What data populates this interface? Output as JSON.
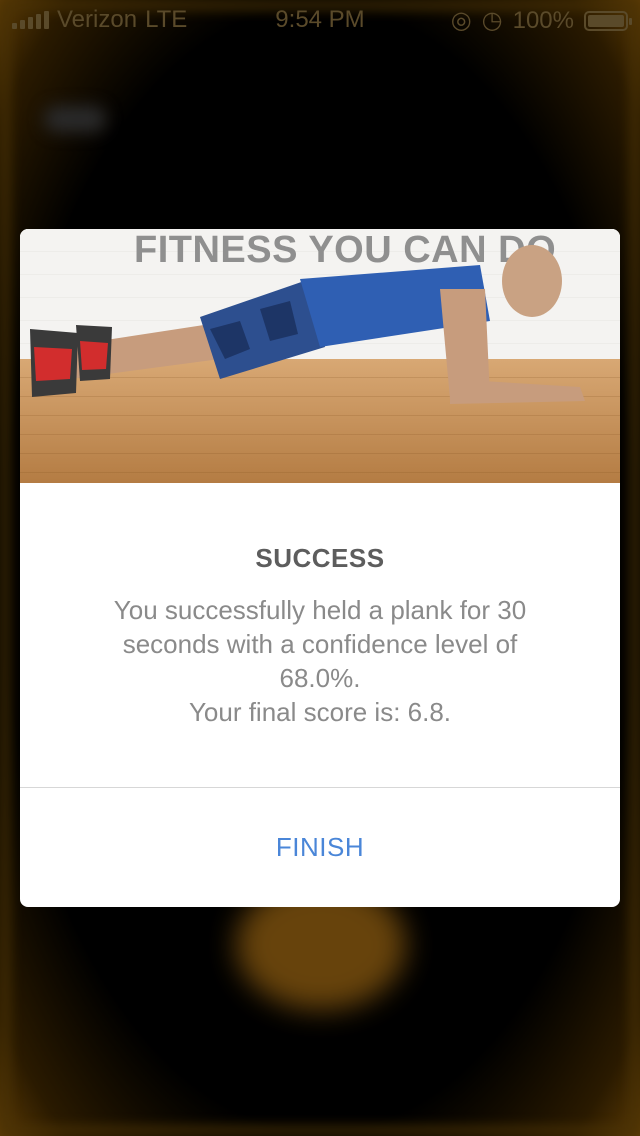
{
  "status_bar": {
    "carrier": "Verizon",
    "network": "LTE",
    "time": "9:54 PM",
    "battery": "100%"
  },
  "dialog": {
    "image_caption": "FITNESS YOU CAN DO",
    "title": "SUCCESS",
    "message_lines": [
      "You successfully held a plank for 30",
      "seconds with a confidence level of",
      "68.0%.",
      "Your final score is: 6.8."
    ],
    "finish_label": "FINISH"
  },
  "colors": {
    "accent": "#4a86d8",
    "title": "#5d5d5d",
    "body_text": "#8a8a8a",
    "backdrop_glow": "#8a5a10"
  },
  "icons": [
    "signal-icon",
    "location-icon",
    "alarm-icon",
    "battery-icon"
  ]
}
